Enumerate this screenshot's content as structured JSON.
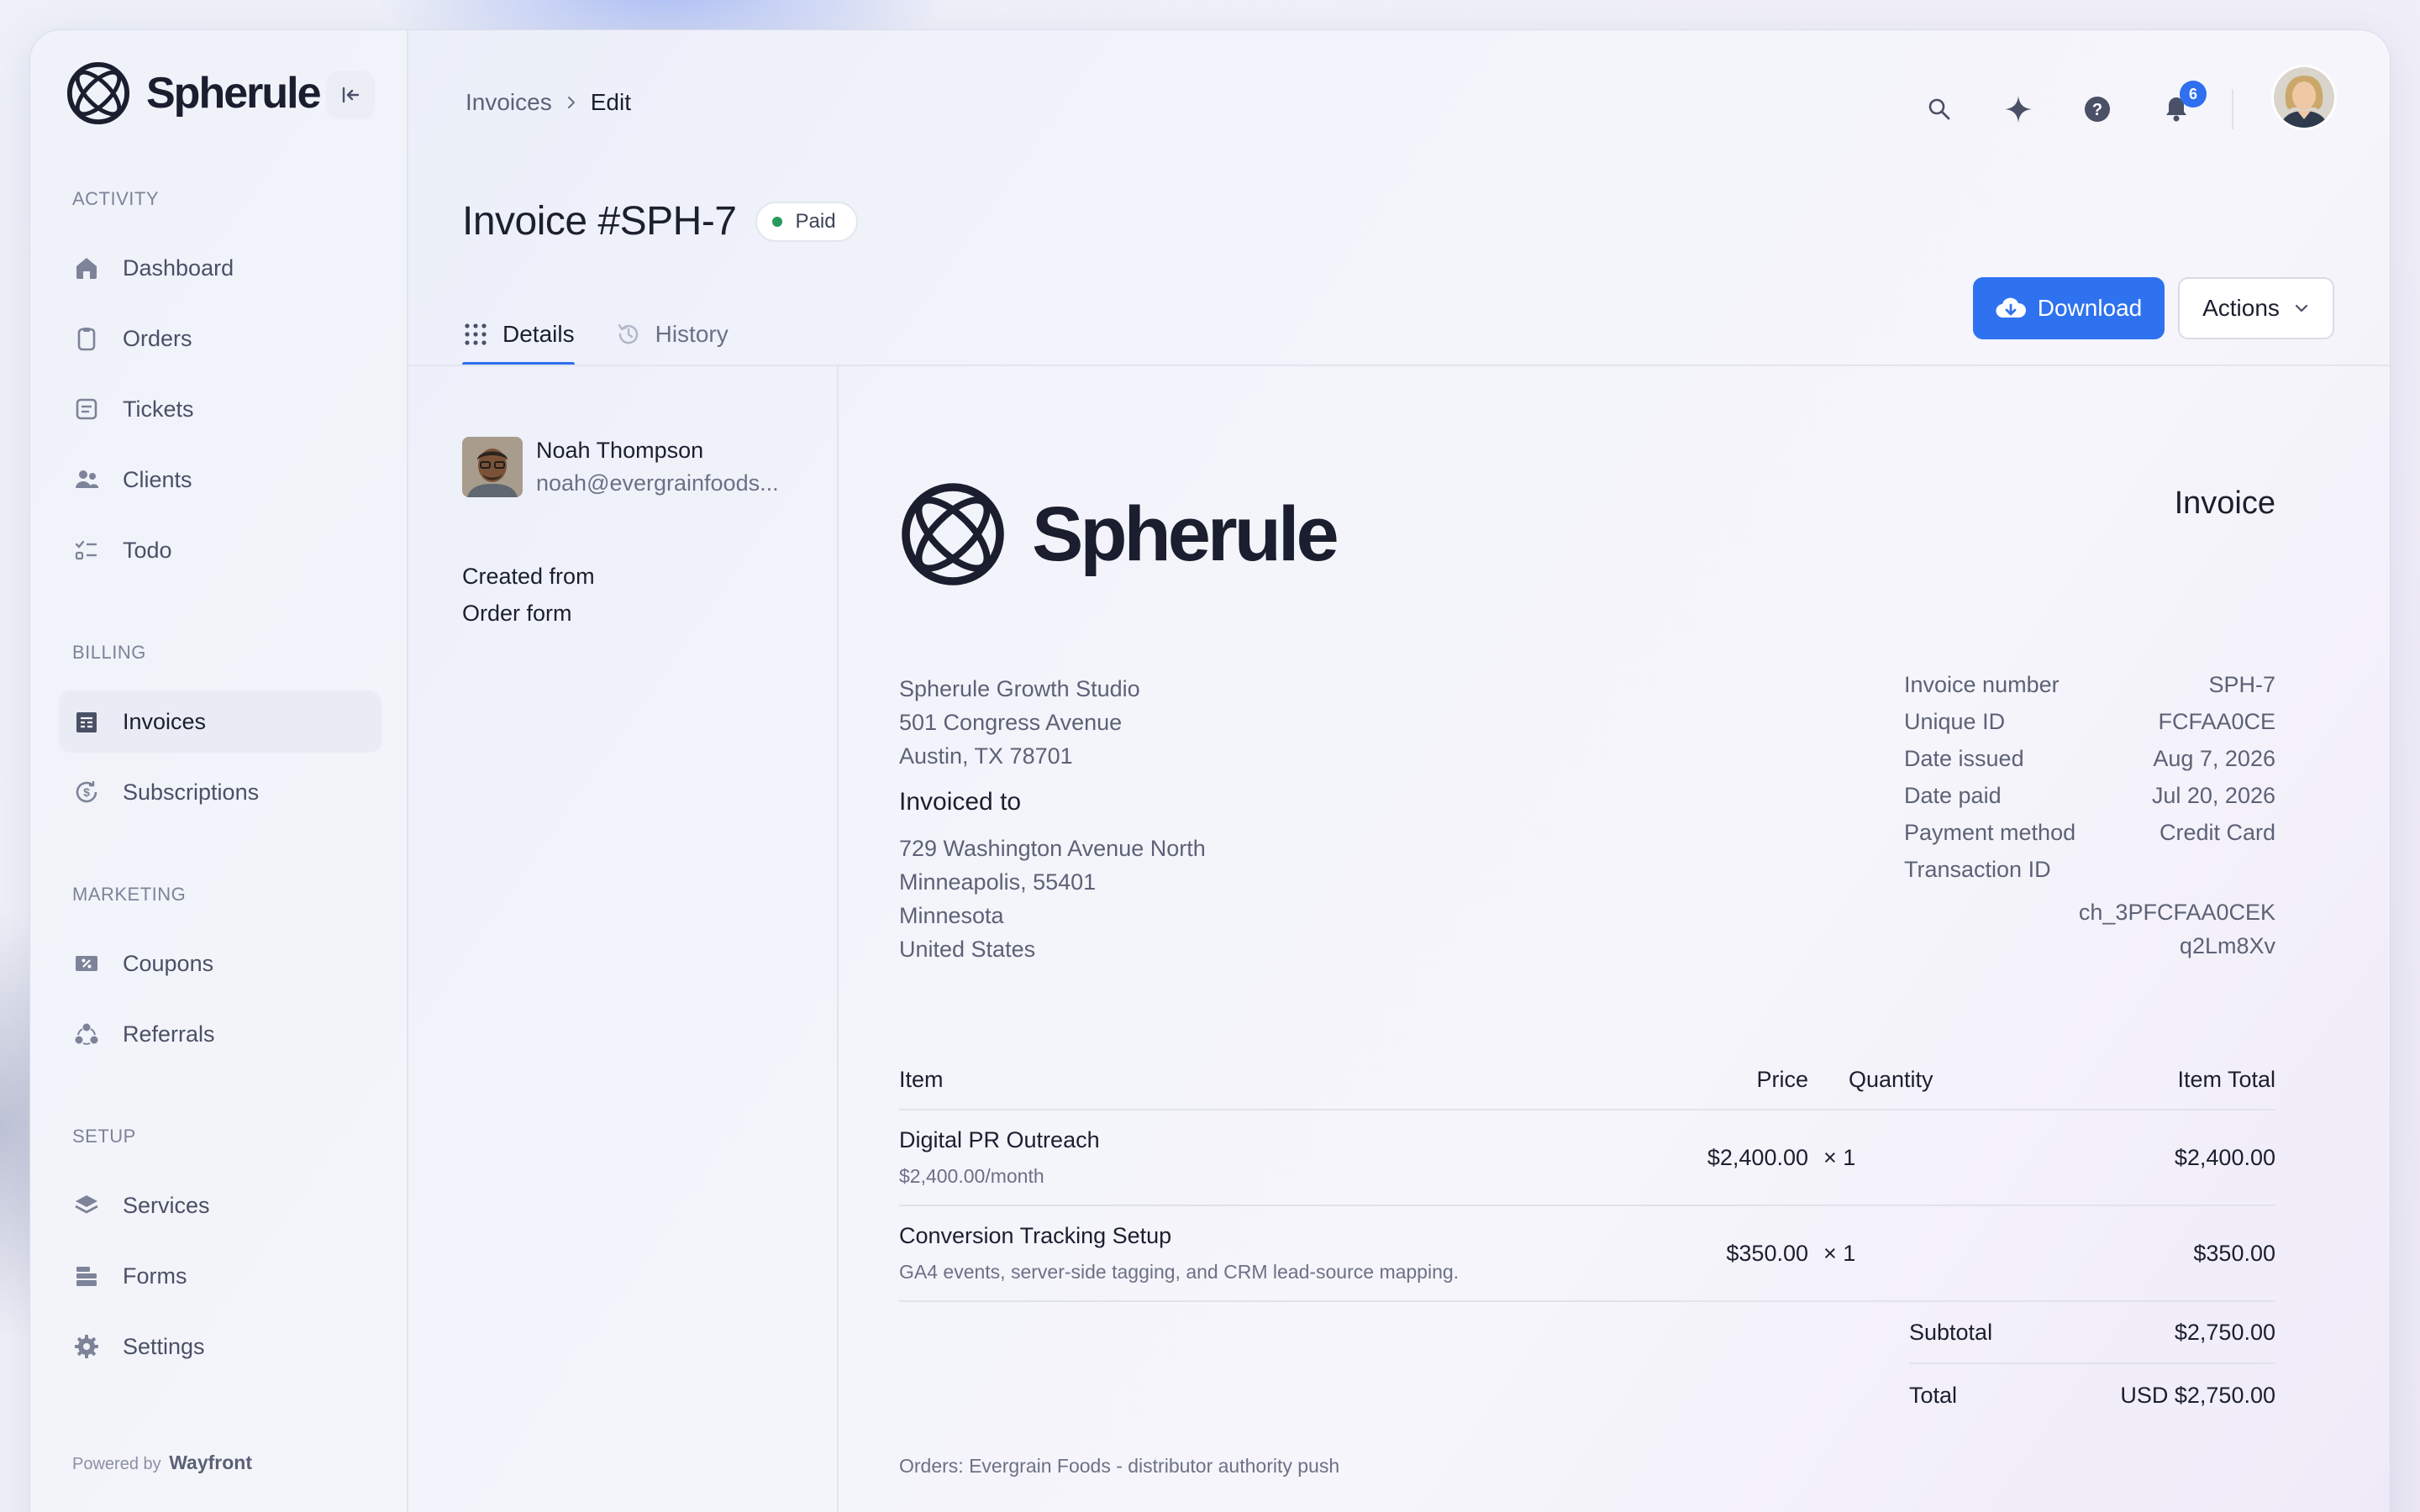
{
  "app": {
    "brand_name": "Spherule",
    "powered_by_prefix": "Powered by",
    "powered_by_name": "Wayfront"
  },
  "sidebar": {
    "sections": [
      {
        "label": "ACTIVITY",
        "items": [
          {
            "label": "Dashboard",
            "icon": "home-icon"
          },
          {
            "label": "Orders",
            "icon": "clipboard-icon"
          },
          {
            "label": "Tickets",
            "icon": "ticket-icon"
          },
          {
            "label": "Clients",
            "icon": "users-icon"
          },
          {
            "label": "Todo",
            "icon": "checklist-icon"
          }
        ]
      },
      {
        "label": "BILLING",
        "items": [
          {
            "label": "Invoices",
            "icon": "invoice-icon",
            "active": true
          },
          {
            "label": "Subscriptions",
            "icon": "dollar-cycle-icon"
          }
        ]
      },
      {
        "label": "MARKETING",
        "items": [
          {
            "label": "Coupons",
            "icon": "coupon-icon"
          },
          {
            "label": "Referrals",
            "icon": "referral-icon"
          }
        ]
      },
      {
        "label": "SETUP",
        "items": [
          {
            "label": "Services",
            "icon": "layers-icon"
          },
          {
            "label": "Forms",
            "icon": "forms-icon"
          },
          {
            "label": "Settings",
            "icon": "gear-icon"
          }
        ]
      }
    ]
  },
  "header": {
    "breadcrumb": [
      "Invoices",
      "Edit"
    ],
    "notification_count": "6"
  },
  "page": {
    "title": "Invoice #SPH-7",
    "status": "Paid",
    "tabs": [
      "Details",
      "History"
    ],
    "download_label": "Download",
    "actions_label": "Actions"
  },
  "client": {
    "name": "Noah Thompson",
    "email": "noah@evergrainfoods..."
  },
  "created_from": {
    "line1": "Created from",
    "line2": "Order form"
  },
  "invoice": {
    "heading": "Invoice",
    "logo_text": "Spherule",
    "from": [
      "Spherule Growth Studio",
      "501 Congress Avenue",
      "Austin, TX 78701"
    ],
    "invoiced_to_title": "Invoiced to",
    "to": [
      "729 Washington Avenue North",
      "Minneapolis, 55401",
      "Minnesota",
      "United States"
    ],
    "meta": [
      {
        "label": "Invoice number",
        "value": "SPH-7"
      },
      {
        "label": "Unique ID",
        "value": "FCFAA0CE"
      },
      {
        "label": "Date issued",
        "value": "Aug 7, 2026"
      },
      {
        "label": "Date paid",
        "value": "Jul 20, 2026"
      },
      {
        "label": "Payment method",
        "value": "Credit Card"
      },
      {
        "label": "Transaction ID",
        "value": ""
      }
    ],
    "transaction_id_lines": [
      "ch_3PFCFAA0CEK",
      "q2Lm8Xv"
    ],
    "columns": [
      "Item",
      "Price",
      "Quantity",
      "Item Total"
    ],
    "items": [
      {
        "name": "Digital PR Outreach",
        "sub": "$2,400.00/month",
        "price": "$2,400.00",
        "qty": "× 1",
        "total": "$2,400.00"
      },
      {
        "name": "Conversion Tracking Setup",
        "sub": "GA4 events, server-side tagging, and CRM lead-source mapping.",
        "price": "$350.00",
        "qty": "× 1",
        "total": "$350.00"
      }
    ],
    "subtotal_label": "Subtotal",
    "subtotal_value": "$2,750.00",
    "total_label": "Total",
    "total_value": "USD $2,750.00",
    "footer_note": "Orders: Evergrain Foods - distributor authority push"
  },
  "colors": {
    "accent": "#2f72f0",
    "paid_dot": "#27995a",
    "text_primary": "#1b1f2e",
    "text_muted": "#5c6276"
  }
}
